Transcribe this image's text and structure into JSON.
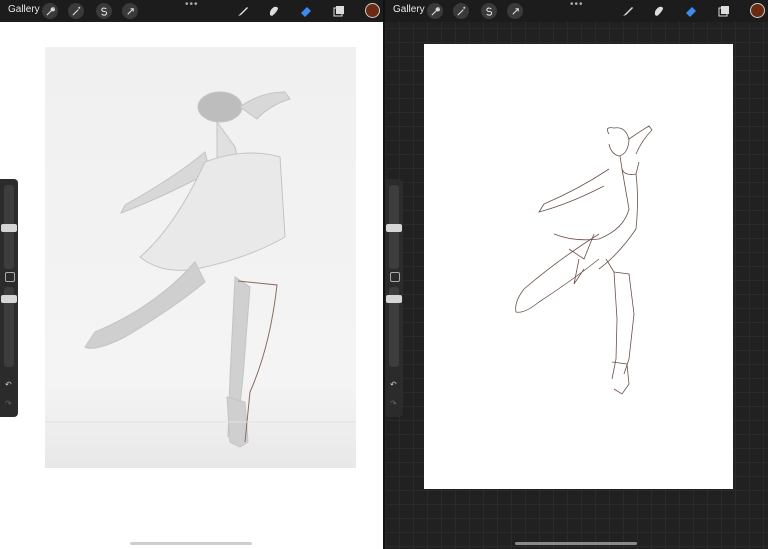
{
  "left_screen": {
    "gallery_label": "Gallery",
    "toolbar": {
      "tools": [
        "wrench-icon",
        "magic-wand-icon",
        "selection-icon",
        "transform-icon"
      ],
      "more": "•••",
      "right_tools": [
        "brush-icon",
        "smudge-icon",
        "eraser-icon",
        "layers-icon"
      ],
      "active_tool": "eraser-icon",
      "color": "#6b2a12"
    },
    "sidebar": {
      "brush_size_level": 0.3,
      "opacity_level": 0.55
    },
    "undo_label": "↶",
    "redo_label": "↷"
  },
  "right_screen": {
    "gallery_label": "Gallery",
    "toolbar": {
      "more": "•••",
      "active_tool": "eraser-icon",
      "color": "#6b2a12"
    },
    "undo_label": "↶",
    "redo_label": "↷"
  },
  "colors": {
    "accent": "#3b8cf0",
    "stroke": "#6b5048"
  }
}
